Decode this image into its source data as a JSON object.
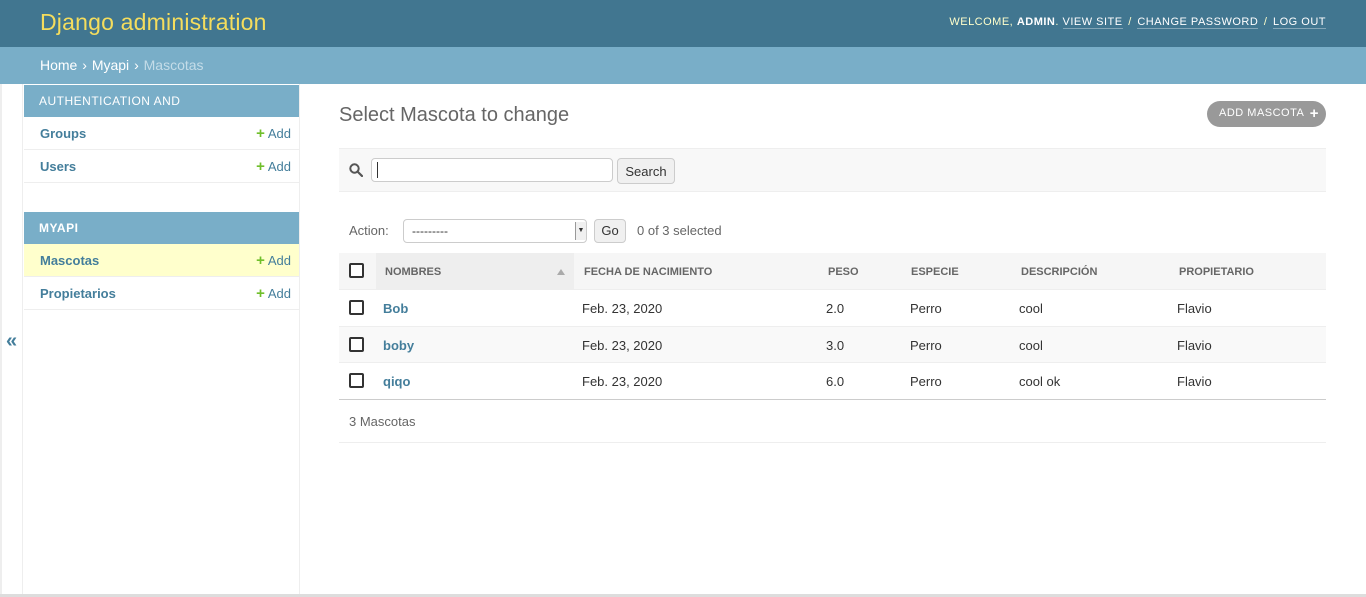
{
  "header": {
    "branding": "Django administration",
    "welcome": "WELCOME,",
    "username": "ADMIN",
    "view_site": "VIEW SITE",
    "change_password": "CHANGE PASSWORD",
    "log_out": "LOG OUT",
    "sep": "/"
  },
  "breadcrumbs": {
    "home": "Home",
    "app": "Myapi",
    "current": "Mascotas",
    "sep": "›"
  },
  "sidebar": {
    "toggle": "«",
    "modules": [
      {
        "caption": "Authentication and Authorization",
        "items": [
          {
            "label": "Groups",
            "add": "Add"
          },
          {
            "label": "Users",
            "add": "Add"
          }
        ]
      },
      {
        "caption": "Myapi",
        "items": [
          {
            "label": "Mascotas",
            "add": "Add"
          },
          {
            "label": "Propietarios",
            "add": "Add"
          }
        ]
      }
    ]
  },
  "content": {
    "title": "Select Mascota to change",
    "add_button": "ADD MASCOTA",
    "search_button": "Search",
    "search_value": "",
    "action_label": "Action:",
    "action_selected": "---------",
    "go_button": "Go",
    "selected_counter": "0 of 3 selected",
    "columns": [
      "Nombres",
      "Fecha de nacimiento",
      "Peso",
      "Especie",
      "Descripción",
      "Propietario"
    ],
    "rows": [
      {
        "nombre": "Bob",
        "fecha": "Feb. 23, 2020",
        "peso": "2.0",
        "especie": "Perro",
        "descripcion": "cool",
        "propietario": "Flavio"
      },
      {
        "nombre": "boby",
        "fecha": "Feb. 23, 2020",
        "peso": "3.0",
        "especie": "Perro",
        "descripcion": "cool",
        "propietario": "Flavio"
      },
      {
        "nombre": "qiqo",
        "fecha": "Feb. 23, 2020",
        "peso": "6.0",
        "especie": "Perro",
        "descripcion": "cool ok",
        "propietario": "Flavio"
      }
    ],
    "paginator": "3 Mascotas"
  },
  "colors": {
    "header_bg": "#417690",
    "branding": "#f5dd5d",
    "breadcrumbs_bg": "#79aec8",
    "link": "#447e9b",
    "add_plus": "#70bf2b",
    "current_row": "#ffffcc"
  }
}
